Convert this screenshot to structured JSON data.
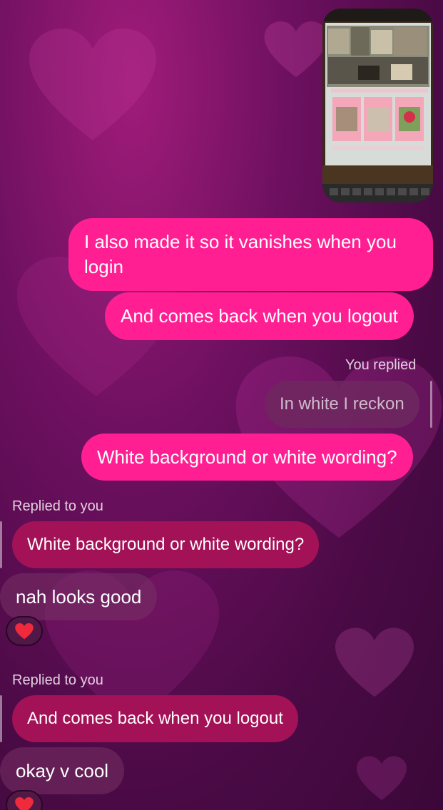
{
  "colors": {
    "outgoing_bubble": "#ff1f93",
    "incoming_bubble": "#7a3266",
    "reply_bubble": "#a31156",
    "background": "#6e1060"
  },
  "photo": {
    "icon": "laptop-screenshot-photo",
    "caption_text": "Login or make an account to add things to cart",
    "products": [
      "Bed",
      "Bunny",
      "Strawberry"
    ]
  },
  "messages": {
    "m1": "I also made it so it vanishes when you login",
    "m2": "And comes back when you logout",
    "you_replied_label": "You replied",
    "quoted_mine": "In white I reckon",
    "m3": "White background or white wording?",
    "replied_to_you_label_1": "Replied to you",
    "quoted_theirs_1": "White background or white wording?",
    "m4": "nah looks good",
    "reaction_1": "❤️",
    "replied_to_you_label_2": "Replied to you",
    "quoted_theirs_2": "And comes back when you logout",
    "m5": "okay v cool",
    "reaction_2": "❤️"
  }
}
